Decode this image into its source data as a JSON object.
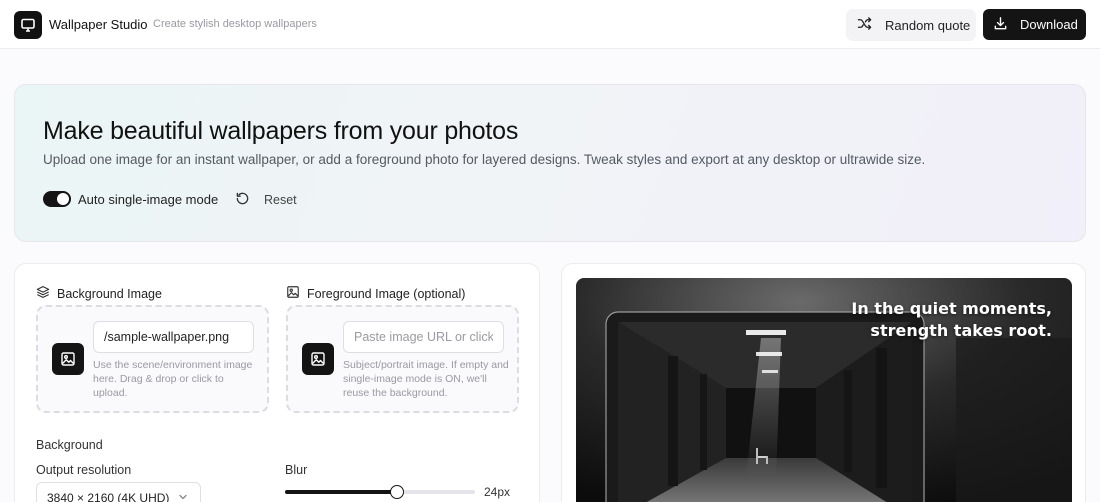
{
  "header": {
    "app_title": "Wallpaper Studio",
    "app_subtitle": "Create stylish desktop wallpapers",
    "random_quote_label": "Random quote",
    "download_label": "Download"
  },
  "hero": {
    "title": "Make beautiful wallpapers from your photos",
    "subtitle": "Upload one image for an instant wallpaper, or add a foreground photo for layered designs. Tweak styles and export at any desktop or ultrawide size.",
    "auto_mode_label": "Auto single-image mode",
    "auto_mode_on": true,
    "reset_label": "Reset"
  },
  "background_image": {
    "heading": "Background Image",
    "input_value": "/sample-wallpaper.png",
    "help": "Use the scene/environment image here. Drag & drop or click to upload."
  },
  "foreground_image": {
    "heading": "Foreground Image (optional)",
    "input_placeholder": "Paste image URL or click to upload",
    "help": "Subject/portrait image. If empty and single-image mode is ON, we'll reuse the background."
  },
  "background_settings": {
    "section_label": "Background",
    "resolution_label": "Output resolution",
    "resolution_value": "3840 × 2160 (4K UHD)",
    "blur_label": "Blur",
    "blur_value": "24px",
    "blur_fraction": 0.59
  },
  "preview": {
    "quote_line1": "In the quiet moments,",
    "quote_line2": "strength takes root."
  },
  "icons": {
    "logo": "monitor-icon",
    "random_quote": "shuffle-icon",
    "download": "download-icon",
    "reset": "rotate-ccw-icon",
    "background_heading": "layers-icon",
    "foreground_heading": "image-icon",
    "dropzone": "image-icon",
    "select": "chevron-down-icon"
  }
}
